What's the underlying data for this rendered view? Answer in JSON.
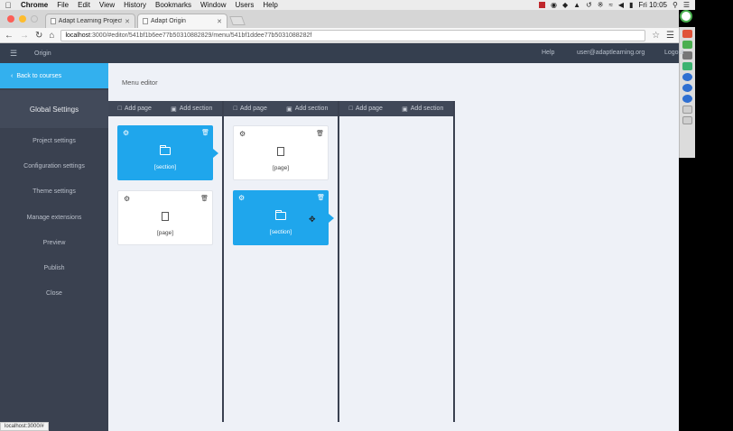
{
  "menubar": {
    "app": "Chrome",
    "items": [
      "File",
      "Edit",
      "View",
      "History",
      "Bookmarks",
      "Window",
      "Users",
      "Help"
    ],
    "clock": "Fri 10:05"
  },
  "tabs": [
    {
      "title": "Adapt Learning Project Co",
      "active": false
    },
    {
      "title": "Adapt Origin",
      "active": true
    }
  ],
  "address": {
    "host": "localhost",
    "path": ":3000/#editor/541bf1b6ee77b50310882829/menu/541bf1ddee77b5031088282f"
  },
  "appbar": {
    "title": "Origin",
    "help": "Help",
    "user": "user@adaptlearning.org",
    "logout": "Logout"
  },
  "sidebar": {
    "back": "Back to courses",
    "heading": "Global Settings",
    "items": [
      "Project settings",
      "Configuration settings",
      "Theme settings",
      "Manage extensions",
      "Preview",
      "Publish",
      "Close"
    ]
  },
  "editor": {
    "heading": "Menu editor",
    "toolbar": {
      "add_page": "Add page",
      "add_section": "Add section"
    },
    "columns": [
      {
        "cards": [
          {
            "type": "section",
            "label": "[section]",
            "selected": true
          },
          {
            "type": "page",
            "label": "[page]",
            "selected": false
          }
        ]
      },
      {
        "cards": [
          {
            "type": "page",
            "label": "[page]",
            "selected": false
          },
          {
            "type": "section",
            "label": "[section]",
            "selected": true
          }
        ]
      },
      {
        "cards": []
      }
    ]
  },
  "status_url": "localhost:3000/#",
  "colors": {
    "accent": "#1fa6ec",
    "sidebar": "#3a4150",
    "appbar": "#353f4f",
    "background": "#eef1f7"
  }
}
